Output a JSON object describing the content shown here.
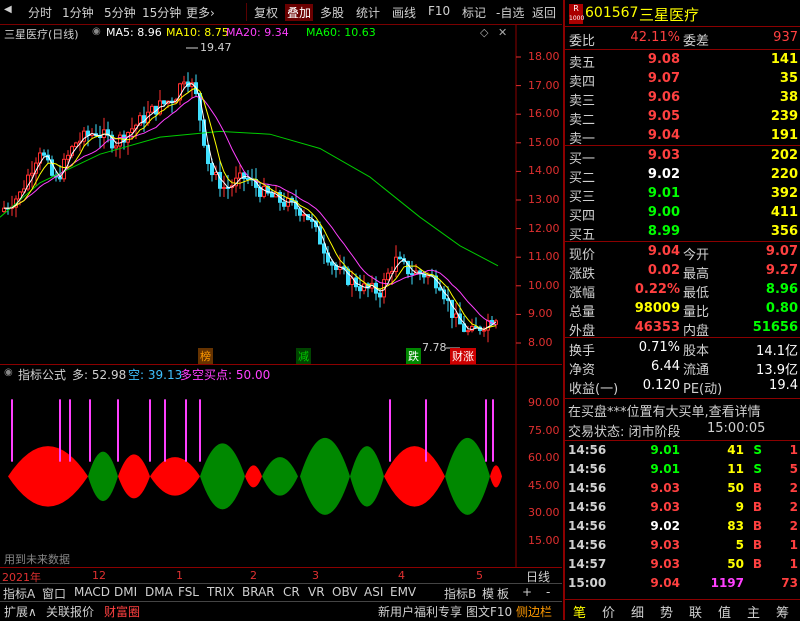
{
  "toolbar": {
    "items": [
      "分时",
      "1分钟",
      "5分钟",
      "15分钟",
      "更多›",
      "复权",
      "叠加",
      "多股",
      "统计",
      "画线",
      "F10",
      "标记",
      "-自选",
      "返回"
    ]
  },
  "chart": {
    "title": "三星医疗(日线)",
    "ma": [
      {
        "label": "MA5: 8.96",
        "color": "#ffffff"
      },
      {
        "label": "MA10: 8.75",
        "color": "#ffff00"
      },
      {
        "label": "MA20: 9.34",
        "color": "#ff40ff"
      },
      {
        "label": "MA60: 10.63",
        "color": "#00ff00"
      }
    ],
    "high_label": "19.47",
    "low_label": "7.78",
    "price_ticks": [
      "18.00",
      "17.00",
      "16.00",
      "15.00",
      "14.00",
      "13.00",
      "12.00",
      "11.00",
      "10.00",
      "9.00",
      "8.00"
    ],
    "events": [
      {
        "text": "榜",
        "color": "#ff9900"
      },
      {
        "text": "减",
        "color": "#00cc00"
      },
      {
        "text": "跌",
        "color": "#ffffff",
        "bg": "#008800"
      },
      {
        "text": "财涨",
        "color": "#ffffff",
        "bg": "#cc0000"
      }
    ]
  },
  "indicator": {
    "name": "指标公式",
    "long": "多: 52.98",
    "short": "空: 39.13",
    "point": "多空买点: 50.00",
    "ticks": [
      "90.00",
      "75.00",
      "60.00",
      "45.00",
      "30.00",
      "15.00"
    ],
    "note": "用到未来数据"
  },
  "time_axis": {
    "labels": [
      "2021年",
      "12",
      "1",
      "2",
      "3",
      "4",
      "5"
    ],
    "period": "日线"
  },
  "bottom_tabs": [
    "指标A",
    "窗口",
    "MACD",
    "DMI",
    "DMA",
    "FSL",
    "TRIX",
    "BRAR",
    "CR",
    "VR",
    "OBV",
    "ASI",
    "EMV",
    "指标B",
    "模",
    "板",
    "+",
    "-"
  ],
  "bottom_tabs2": [
    "扩展∧",
    "关联报价",
    "财富圈",
    "新用户福利专享",
    "图文F10",
    "侧边栏"
  ],
  "quote": {
    "code": "601567",
    "name": "三星医疗",
    "badge_top": "R",
    "badge_bottom": "1000",
    "weibi": {
      "label": "委比",
      "value": "42.11%",
      "label2": "委差",
      "value2": "937"
    },
    "sell": [
      {
        "label": "卖五",
        "price": "9.08",
        "vol": "141"
      },
      {
        "label": "卖四",
        "price": "9.07",
        "vol": "35"
      },
      {
        "label": "卖三",
        "price": "9.06",
        "vol": "38"
      },
      {
        "label": "卖二",
        "price": "9.05",
        "vol": "239"
      },
      {
        "label": "卖一",
        "price": "9.04",
        "vol": "191"
      }
    ],
    "buy": [
      {
        "label": "买一",
        "price": "9.03",
        "vol": "202",
        "pc": "#ff4040"
      },
      {
        "label": "买二",
        "price": "9.02",
        "vol": "220",
        "pc": "#ffffff"
      },
      {
        "label": "买三",
        "price": "9.01",
        "vol": "392",
        "pc": "#00ff00"
      },
      {
        "label": "买四",
        "price": "9.00",
        "vol": "411",
        "pc": "#00ff00"
      },
      {
        "label": "买五",
        "price": "8.99",
        "vol": "356",
        "pc": "#00ff00"
      }
    ],
    "stats": [
      {
        "l1": "现价",
        "v1": "9.04",
        "c1": "#ff4040",
        "l2": "今开",
        "v2": "9.07",
        "c2": "#ff4040"
      },
      {
        "l1": "涨跌",
        "v1": "0.02",
        "c1": "#ff4040",
        "l2": "最高",
        "v2": "9.27",
        "c2": "#ff4040"
      },
      {
        "l1": "涨幅",
        "v1": "0.22%",
        "c1": "#ff4040",
        "l2": "最低",
        "v2": "8.96",
        "c2": "#00ff00"
      },
      {
        "l1": "总量",
        "v1": "98009",
        "c1": "#ffff00",
        "l2": "量比",
        "v2": "0.80",
        "c2": "#00ff00"
      },
      {
        "l1": "外盘",
        "v1": "46353",
        "c1": "#ff4040",
        "l2": "内盘",
        "v2": "51656",
        "c2": "#00ff00"
      }
    ],
    "stats2": [
      {
        "l1": "换手",
        "v1": "0.71%",
        "l2": "股本",
        "v2": "14.1亿"
      },
      {
        "l1": "净资",
        "v1": "6.44",
        "l2": "流通",
        "v2": "13.9亿"
      },
      {
        "l1": "收益(一)",
        "v1": "0.120",
        "l2": "PE(动)",
        "v2": "19.4"
      }
    ],
    "notice": "在买盘***位置有大买单,查看详情",
    "status_label": "交易状态: 闭市阶段",
    "status_time": "15:00:05",
    "ticks": [
      {
        "t": "14:56",
        "p": "9.01",
        "pc": "#00ff00",
        "v": "41",
        "vc": "#ffff00",
        "s": "S",
        "sc": "#00ff00",
        "n": "1"
      },
      {
        "t": "14:56",
        "p": "9.01",
        "pc": "#00ff00",
        "v": "11",
        "vc": "#ffff00",
        "s": "S",
        "sc": "#00ff00",
        "n": "5"
      },
      {
        "t": "14:56",
        "p": "9.03",
        "pc": "#ff4040",
        "v": "50",
        "vc": "#ffff00",
        "s": "B",
        "sc": "#ff4040",
        "n": "2"
      },
      {
        "t": "14:56",
        "p": "9.03",
        "pc": "#ff4040",
        "v": "9",
        "vc": "#ffff00",
        "s": "B",
        "sc": "#ff4040",
        "n": "2"
      },
      {
        "t": "14:56",
        "p": "9.02",
        "pc": "#ffffff",
        "v": "83",
        "vc": "#ffff00",
        "s": "B",
        "sc": "#ff4040",
        "n": "2"
      },
      {
        "t": "14:56",
        "p": "9.03",
        "pc": "#ff4040",
        "v": "5",
        "vc": "#ffff00",
        "s": "B",
        "sc": "#ff4040",
        "n": "1"
      },
      {
        "t": "14:57",
        "p": "9.03",
        "pc": "#ff4040",
        "v": "50",
        "vc": "#ffff00",
        "s": "B",
        "sc": "#ff4040",
        "n": "1"
      },
      {
        "t": "15:00",
        "p": "9.04",
        "pc": "#ff4040",
        "v": "1197",
        "vc": "#ff40ff",
        "s": "",
        "sc": "#ff4040",
        "n": "73"
      }
    ],
    "right_tabs": [
      "笔",
      "价",
      "细",
      "势",
      "联",
      "值",
      "主",
      "筹"
    ]
  }
}
